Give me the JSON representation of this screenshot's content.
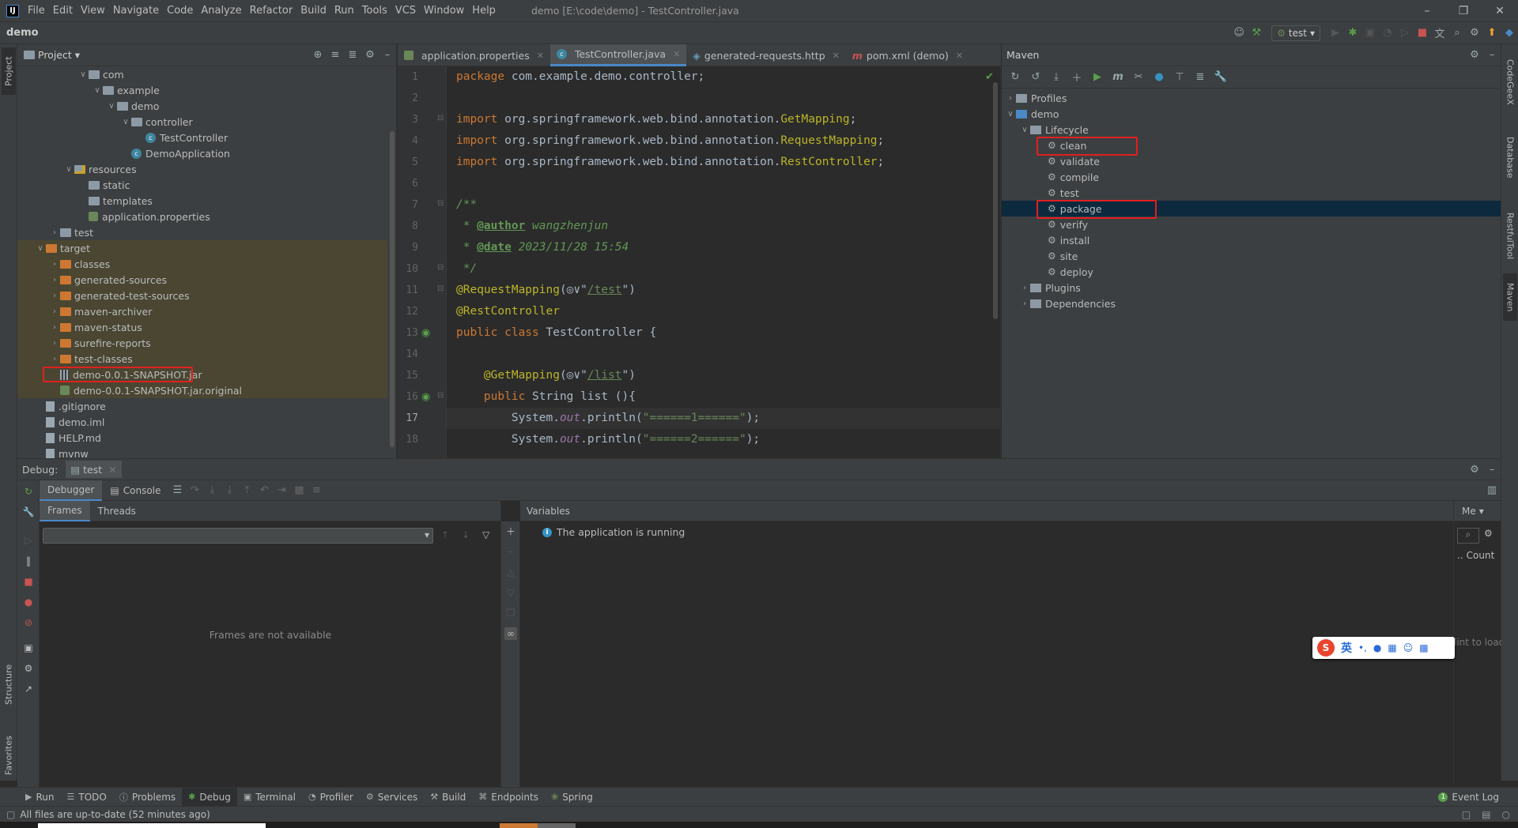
{
  "menu": {
    "items": [
      "File",
      "Edit",
      "View",
      "Navigate",
      "Code",
      "Analyze",
      "Refactor",
      "Build",
      "Run",
      "Tools",
      "VCS",
      "Window",
      "Help"
    ],
    "window_title": "demo [E:\\code\\demo] - TestController.java"
  },
  "nav": {
    "project": "demo",
    "run_config": "test"
  },
  "left_strip": {
    "project": "Project",
    "structure": "Structure",
    "favorites": "Favorites"
  },
  "right_strip": {
    "codegeex": "CodeGeeX",
    "database": "Database",
    "restful": "RestfulTool",
    "maven": "Maven"
  },
  "project_panel": {
    "title": "Project",
    "rows": [
      {
        "label": "com",
        "depth": 4,
        "icon": "folder",
        "open": true
      },
      {
        "label": "example",
        "depth": 5,
        "icon": "folder",
        "open": true
      },
      {
        "label": "demo",
        "depth": 6,
        "icon": "folder",
        "open": true
      },
      {
        "label": "controller",
        "depth": 7,
        "icon": "folder",
        "open": true
      },
      {
        "label": "TestController",
        "depth": 8,
        "icon": "class"
      },
      {
        "label": "DemoApplication",
        "depth": 7,
        "icon": "class-spring"
      },
      {
        "label": "resources",
        "depth": 3,
        "icon": "folder-res",
        "open": true
      },
      {
        "label": "static",
        "depth": 4,
        "icon": "folder"
      },
      {
        "label": "templates",
        "depth": 4,
        "icon": "folder"
      },
      {
        "label": "application.properties",
        "depth": 4,
        "icon": "props"
      },
      {
        "label": "test",
        "depth": 2,
        "icon": "folder",
        "closed": true
      },
      {
        "label": "target",
        "depth": 1,
        "icon": "folder-orange",
        "open": true,
        "target": true
      },
      {
        "label": "classes",
        "depth": 2,
        "icon": "folder-orange",
        "closed": true,
        "target": true
      },
      {
        "label": "generated-sources",
        "depth": 2,
        "icon": "folder-orange",
        "closed": true,
        "target": true
      },
      {
        "label": "generated-test-sources",
        "depth": 2,
        "icon": "folder-orange",
        "closed": true,
        "target": true
      },
      {
        "label": "maven-archiver",
        "depth": 2,
        "icon": "folder-orange",
        "closed": true,
        "target": true
      },
      {
        "label": "maven-status",
        "depth": 2,
        "icon": "folder-orange",
        "closed": true,
        "target": true
      },
      {
        "label": "surefire-reports",
        "depth": 2,
        "icon": "folder-orange",
        "closed": true,
        "target": true
      },
      {
        "label": "test-classes",
        "depth": 2,
        "icon": "folder-orange",
        "closed": true,
        "target": true
      },
      {
        "label": "demo-0.0.1-SNAPSHOT.jar",
        "depth": 2,
        "icon": "jar",
        "target": true,
        "highlight": true
      },
      {
        "label": "demo-0.0.1-SNAPSHOT.jar.original",
        "depth": 2,
        "icon": "props",
        "target": true
      },
      {
        "label": ".gitignore",
        "depth": 1,
        "icon": "file"
      },
      {
        "label": "demo.iml",
        "depth": 1,
        "icon": "file"
      },
      {
        "label": "HELP.md",
        "depth": 1,
        "icon": "file"
      },
      {
        "label": "mvnw",
        "depth": 1,
        "icon": "file"
      }
    ]
  },
  "editor_tabs": [
    {
      "label": "application.properties",
      "icon": "props"
    },
    {
      "label": "TestController.java",
      "icon": "class",
      "active": true
    },
    {
      "label": "generated-requests.http",
      "icon": "http"
    },
    {
      "label": "pom.xml (demo)",
      "icon": "maven"
    }
  ],
  "code_lines": [
    "1",
    "2",
    "3",
    "4",
    "5",
    "6",
    "7",
    "8",
    "9",
    "10",
    "11",
    "12",
    "13",
    "14",
    "15",
    "16",
    "17",
    "18"
  ],
  "code": {
    "l1_kw": "package ",
    "l1_rest": "com.example.demo.controller;",
    "l3_kw": "import ",
    "l3_pkg": "org.springframework.web.bind.annotation.",
    "l3_cls": "GetMapping",
    "l4_pkg": "org.springframework.web.bind.annotation.",
    "l4_cls": "RequestMapping",
    "l5_pkg": "org.springframework.web.bind.annotation.",
    "l5_cls": "RestController",
    "l7": "/**",
    "l8_star": " * ",
    "l8_tag": "@author",
    "l8_val": " wangzhenjun",
    "l9_star": " * ",
    "l9_tag": "@date",
    "l9_val": " 2023/11/28 15:54",
    "l10": " */",
    "l11_ann": "@RequestMapping",
    "l11_url": "/test",
    "l12_ann": "@RestController",
    "l13_kw": "public class ",
    "l13_name": "TestController {",
    "l15_ann": "@GetMapping",
    "l15_url": "/list",
    "l16_kw": "public ",
    "l16_rest": "String list (){",
    "l17_a": "System.",
    "l17_out": "out",
    "l17_b": ".println(",
    "l17_str": "\"======1======\"",
    "l17_c": ");",
    "l18_a": "System.",
    "l18_out": "out",
    "l18_b": ".println(",
    "l18_str": "\"======2======\"",
    "l18_c": ");"
  },
  "maven": {
    "title": "Maven",
    "rows": [
      {
        "label": "Profiles",
        "depth": 0,
        "type": "folder",
        "closed": true
      },
      {
        "label": "demo",
        "depth": 0,
        "type": "module",
        "open": true
      },
      {
        "label": "Lifecycle",
        "depth": 1,
        "type": "folder",
        "open": true
      },
      {
        "label": "clean",
        "depth": 2,
        "type": "goal",
        "highlight": true
      },
      {
        "label": "validate",
        "depth": 2,
        "type": "goal"
      },
      {
        "label": "compile",
        "depth": 2,
        "type": "goal"
      },
      {
        "label": "test",
        "depth": 2,
        "type": "goal"
      },
      {
        "label": "package",
        "depth": 2,
        "type": "goal",
        "highlight": true,
        "selected": true
      },
      {
        "label": "verify",
        "depth": 2,
        "type": "goal"
      },
      {
        "label": "install",
        "depth": 2,
        "type": "goal"
      },
      {
        "label": "site",
        "depth": 2,
        "type": "goal"
      },
      {
        "label": "deploy",
        "depth": 2,
        "type": "goal"
      },
      {
        "label": "Plugins",
        "depth": 1,
        "type": "folder",
        "closed": true
      },
      {
        "label": "Dependencies",
        "depth": 1,
        "type": "folder",
        "closed": true
      }
    ]
  },
  "debug": {
    "label": "Debug:",
    "session": "test",
    "tab_debugger": "Debugger",
    "tab_console": "Console",
    "frames_tab": "Frames",
    "threads_tab": "Threads",
    "frames_empty": "Frames are not available",
    "variables": "Variables",
    "running": "The application is running",
    "mem_label": "Me",
    "count_label": "Count",
    "click_hint": "lint to load",
    "ime_label": "英"
  },
  "bottom_tools": [
    {
      "label": "Run",
      "icon": "run"
    },
    {
      "label": "TODO",
      "icon": "todo"
    },
    {
      "label": "Problems",
      "icon": "problems"
    },
    {
      "label": "Debug",
      "icon": "debug",
      "active": true
    },
    {
      "label": "Terminal",
      "icon": "terminal"
    },
    {
      "label": "Profiler",
      "icon": "profiler"
    },
    {
      "label": "Services",
      "icon": "services"
    },
    {
      "label": "Build",
      "icon": "build"
    },
    {
      "label": "Endpoints",
      "icon": "endpoints"
    },
    {
      "label": "Spring",
      "icon": "spring"
    }
  ],
  "event_log": "Event Log",
  "event_log_count": "1",
  "status": "All files are up-to-date (52 minutes ago)",
  "colors": {
    "accent": "#4a88c7",
    "highlight_box": "#e02020",
    "target_bg": "#4a4632",
    "selected_bg": "#0d293e"
  }
}
